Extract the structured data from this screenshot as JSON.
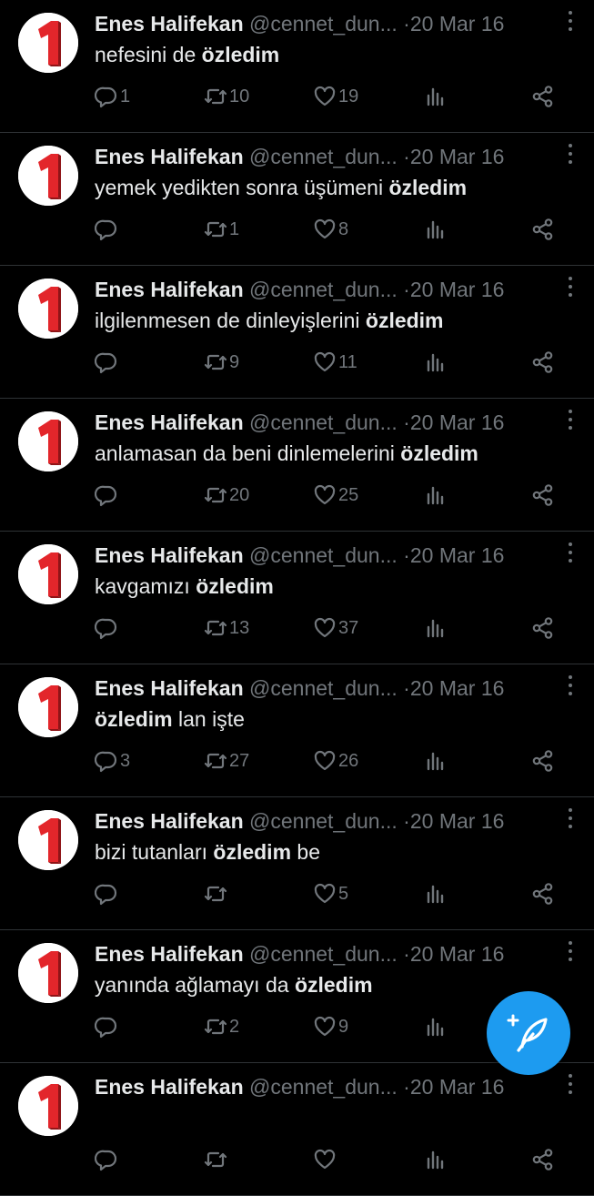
{
  "tweets": [
    {
      "name": "Enes Halifekan",
      "handle": "@cennet_dun...",
      "sep": "·",
      "date": "20 Mar 16",
      "text_before": "nefesini de ",
      "bold": "özledim",
      "text_after": "",
      "replies": "1",
      "retweets": "10",
      "likes": "19"
    },
    {
      "name": "Enes Halifekan",
      "handle": "@cennet_dun...",
      "sep": "·",
      "date": "20 Mar 16",
      "text_before": "yemek yedikten sonra üşümeni ",
      "bold": "özledim",
      "text_after": "",
      "replies": "",
      "retweets": "1",
      "likes": "8"
    },
    {
      "name": "Enes Halifekan",
      "handle": "@cennet_dun...",
      "sep": "·",
      "date": "20 Mar 16",
      "text_before": "ilgilenmesen de dinleyişlerini ",
      "bold": "özledim",
      "text_after": "",
      "replies": "",
      "retweets": "9",
      "likes": "11"
    },
    {
      "name": "Enes Halifekan",
      "handle": "@cennet_dun...",
      "sep": "·",
      "date": "20 Mar 16",
      "text_before": "anlamasan da beni dinlemelerini ",
      "bold": "özledim",
      "text_after": "",
      "replies": "",
      "retweets": "20",
      "likes": "25"
    },
    {
      "name": "Enes Halifekan",
      "handle": "@cennet_dun...",
      "sep": "·",
      "date": "20 Mar 16",
      "text_before": "kavgamızı ",
      "bold": "özledim",
      "text_after": "",
      "replies": "",
      "retweets": "13",
      "likes": "37"
    },
    {
      "name": "Enes Halifekan",
      "handle": "@cennet_dun...",
      "sep": "·",
      "date": "20 Mar 16",
      "text_before": "",
      "bold": "özledim",
      "text_after": " lan işte",
      "replies": "3",
      "retweets": "27",
      "likes": "26"
    },
    {
      "name": "Enes Halifekan",
      "handle": "@cennet_dun...",
      "sep": "·",
      "date": "20 Mar 16",
      "text_before": "bizi tutanları ",
      "bold": "özledim",
      "text_after": " be",
      "replies": "",
      "retweets": "",
      "likes": "5"
    },
    {
      "name": "Enes Halifekan",
      "handle": "@cennet_dun...",
      "sep": "·",
      "date": "20 Mar 16",
      "text_before": "yanında ağlamayı da ",
      "bold": "özledim",
      "text_after": "",
      "replies": "",
      "retweets": "2",
      "likes": "9"
    },
    {
      "name": "Enes Halifekan",
      "handle": "@cennet_dun...",
      "sep": "·",
      "date": "20 Mar 16",
      "text_before": "",
      "bold": "",
      "text_after": "",
      "replies": "",
      "retweets": "",
      "likes": ""
    }
  ],
  "colors": {
    "background": "#000000",
    "text": "#e7e9ea",
    "muted": "#71767b",
    "accent": "#1d9bf0",
    "avatar_red": "#e3262b"
  },
  "icons": {
    "reply": "reply-icon",
    "retweet": "retweet-icon",
    "like": "heart-icon",
    "views": "views-icon",
    "share": "share-icon",
    "more": "more-vertical-icon",
    "compose": "compose-feather-icon"
  },
  "avatar": {
    "glyph": "1"
  }
}
